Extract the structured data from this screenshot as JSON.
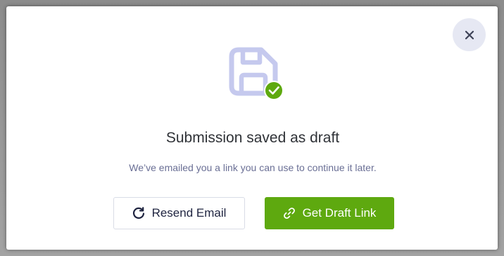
{
  "dialog": {
    "close_icon": "close-icon",
    "status_icon": "floppy-disk-check-icon",
    "title": "Submission saved as draft",
    "message": "We’ve emailed you a link you can use to continue it later.",
    "resend_button": {
      "label": "Resend Email",
      "icon": "refresh-icon"
    },
    "draft_link_button": {
      "label": "Get Draft Link",
      "icon": "link-icon"
    }
  },
  "colors": {
    "accent_green": "#5ea90f",
    "icon_lavender": "#c5c9ee",
    "close_bg": "#e6e8f3",
    "message_text": "#6a6f95"
  }
}
